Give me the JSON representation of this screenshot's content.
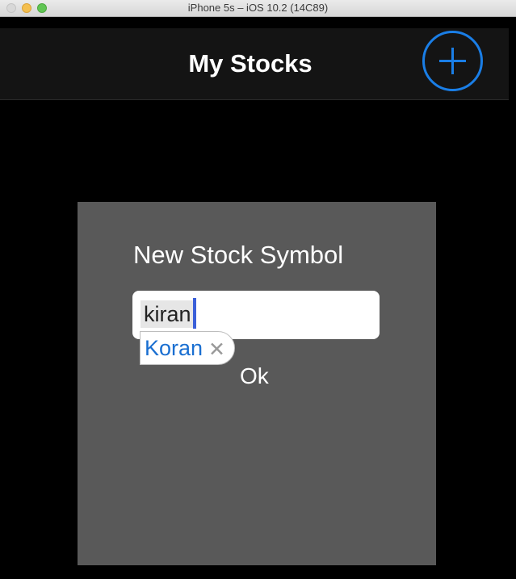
{
  "window": {
    "title": "iPhone 5s – iOS 10.2 (14C89)"
  },
  "navbar": {
    "title": "My Stocks",
    "add_icon": "plus-circle-icon"
  },
  "dialog": {
    "title": "New Stock Symbol",
    "input_value": "kiran",
    "suggestion": "Koran",
    "suggestion_close_icon": "close-icon",
    "ok_label": "Ok"
  },
  "colors": {
    "accent": "#1a7ee6",
    "dialog_bg": "#595959",
    "navbar_bg": "#141414"
  }
}
